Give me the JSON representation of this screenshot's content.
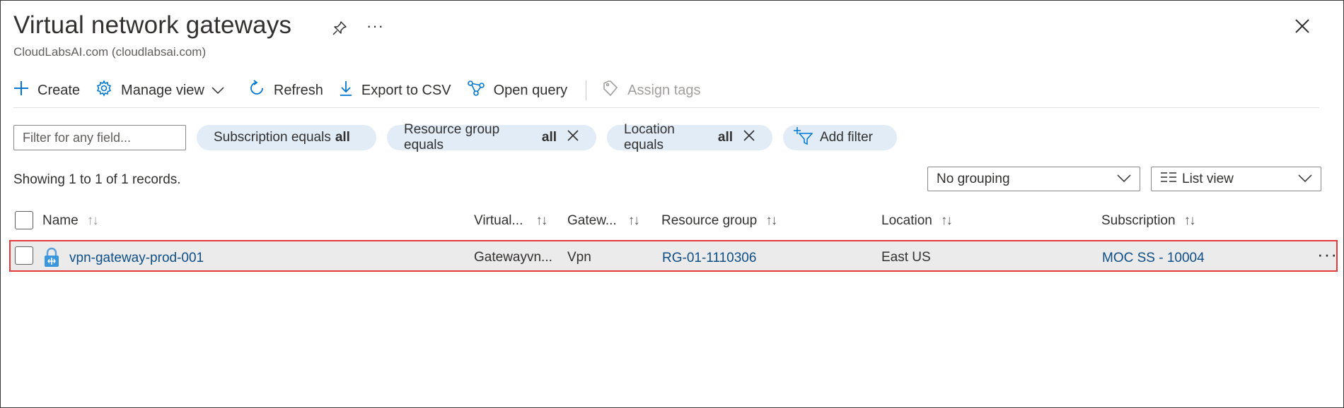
{
  "page": {
    "title": "Virtual network gateways",
    "subtitle": "CloudLabsAI.com (cloudlabsai.com)",
    "more_label": "···"
  },
  "toolbar": {
    "create": "Create",
    "manage_view": "Manage view",
    "refresh": "Refresh",
    "export_csv": "Export to CSV",
    "open_query": "Open query",
    "assign_tags": "Assign tags"
  },
  "filters": {
    "search_placeholder": "Filter for any field...",
    "subscription": {
      "label": "Subscription equals",
      "value": "all"
    },
    "resource_group": {
      "label": "Resource group equals",
      "value": "all"
    },
    "location": {
      "label": "Location equals",
      "value": "all"
    },
    "add_filter": "Add filter"
  },
  "records": {
    "showing": "Showing 1 to 1 of 1 records."
  },
  "view_controls": {
    "grouping": "No grouping",
    "view": "List view"
  },
  "table": {
    "columns": [
      "Name",
      "Virtual...",
      "Gatew...",
      "Resource group",
      "Location",
      "Subscription"
    ],
    "rows": [
      {
        "name": "vpn-gateway-prod-001",
        "virtual": "Gatewayvn...",
        "gateway": "Vpn",
        "resource_group": "RG-01-1110306",
        "location": "East US",
        "subscription": "MOC SS - 10004",
        "more": "···"
      }
    ]
  },
  "colors": {
    "accent": "#0078d4",
    "link": "#0f4e87",
    "pill": "#e1ecf7",
    "highlight_border": "#e23a3a",
    "row_bg": "#ebebeb"
  }
}
